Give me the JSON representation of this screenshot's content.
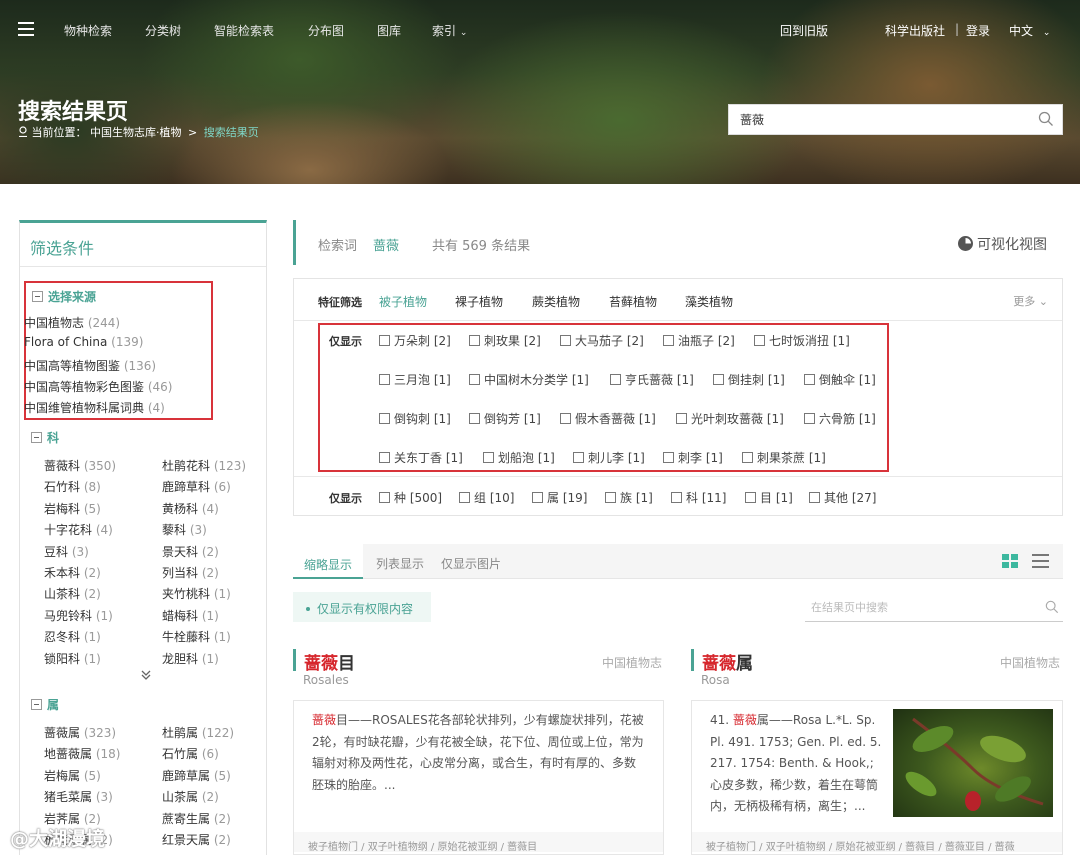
{
  "nav": {
    "items": [
      "物种检索",
      "分类树",
      "智能检索表",
      "分布图",
      "图库",
      "索引"
    ],
    "old_version": "回到旧版",
    "publisher": "科学出版社",
    "separator": "|",
    "login": "登录",
    "language": "中文"
  },
  "page": {
    "title": "搜索结果页",
    "location_label": "当前位置：",
    "crumb_home": "中国生物志库·植物",
    "crumb_sep": ">",
    "crumb_current": "搜索结果页"
  },
  "header_search": {
    "value": "蔷薇"
  },
  "sidebar": {
    "title": "筛选条件",
    "source_title": "选择来源",
    "sources": [
      {
        "name": "中国植物志",
        "count": "(244)"
      },
      {
        "name": "Flora of China",
        "count": "(139)"
      },
      {
        "name": "中国高等植物图鉴",
        "count": "(136)"
      },
      {
        "name": "中国高等植物彩色图鉴",
        "count": "(46)"
      },
      {
        "name": "中国维管植物科属词典",
        "count": "(4)"
      }
    ],
    "family_title": "科",
    "families": [
      {
        "name": "蔷薇科",
        "count": "(350)"
      },
      {
        "name": "杜鹃花科",
        "count": "(123)"
      },
      {
        "name": "石竹科",
        "count": "(8)"
      },
      {
        "name": "鹿蹄草科",
        "count": "(6)"
      },
      {
        "name": "岩梅科",
        "count": "(5)"
      },
      {
        "name": "黄杨科",
        "count": "(4)"
      },
      {
        "name": "十字花科",
        "count": "(4)"
      },
      {
        "name": "藜科",
        "count": "(3)"
      },
      {
        "name": "豆科",
        "count": "(3)"
      },
      {
        "name": "景天科",
        "count": "(2)"
      },
      {
        "name": "禾本科",
        "count": "(2)"
      },
      {
        "name": "列当科",
        "count": "(2)"
      },
      {
        "name": "山茶科",
        "count": "(2)"
      },
      {
        "name": "夹竹桃科",
        "count": "(1)"
      },
      {
        "name": "马兜铃科",
        "count": "(1)"
      },
      {
        "name": "蜡梅科",
        "count": "(1)"
      },
      {
        "name": "忍冬科",
        "count": "(1)"
      },
      {
        "name": "牛栓藤科",
        "count": "(1)"
      },
      {
        "name": "锁阳科",
        "count": "(1)"
      },
      {
        "name": "龙胆科",
        "count": "(1)"
      }
    ],
    "genus_title": "属",
    "genera": [
      {
        "name": "蔷薇属",
        "count": "(323)"
      },
      {
        "name": "杜鹃属",
        "count": "(122)"
      },
      {
        "name": "地蔷薇属",
        "count": "(18)"
      },
      {
        "name": "石竹属",
        "count": "(6)"
      },
      {
        "name": "岩梅属",
        "count": "(5)"
      },
      {
        "name": "鹿蹄草属",
        "count": "(5)"
      },
      {
        "name": "猪毛菜属",
        "count": "(3)"
      },
      {
        "name": "山茶属",
        "count": "(2)"
      },
      {
        "name": "岩荠属",
        "count": "(2)"
      },
      {
        "name": "蔗寄生属",
        "count": "(2)"
      },
      {
        "name": "板凳果属",
        "count": "(2)"
      },
      {
        "name": "红景天属",
        "count": "(2)"
      }
    ]
  },
  "query": {
    "label": "检索词",
    "keyword": "蔷薇",
    "total": "共有 569 条结果",
    "visualize": "可视化视图"
  },
  "filters": {
    "feature_label": "特征筛选",
    "categories": [
      "被子植物",
      "裸子植物",
      "蕨类植物",
      "苔藓植物",
      "藻类植物"
    ],
    "more": "更多",
    "only_label": "仅显示",
    "names": [
      "万朵刺 [2]",
      "刺玫果 [2]",
      "大马茄子 [2]",
      "油瓶子 [2]",
      "七时饭消扭 [1]",
      "三月泡 [1]",
      "中国树木分类学 [1]",
      "亨氏蔷薇 [1]",
      "倒挂刺 [1]",
      "倒触伞 [1]",
      "倒钩刺 [1]",
      "倒钩芳 [1]",
      "假木香蔷薇 [1]",
      "光叶刺玫蔷薇 [1]",
      "六骨筋 [1]",
      "关东丁香 [1]",
      "划船泡 [1]",
      "刺儿李 [1]",
      "刺李 [1]",
      "刺果茶蔗 [1]"
    ],
    "ranks": [
      "种 [500]",
      "组 [10]",
      "属 [19]",
      "族 [1]",
      "科 [11]",
      "目 [1]",
      "其他 [27]"
    ]
  },
  "view_tabs": [
    "缩略显示",
    "列表显示",
    "仅显示图片"
  ],
  "permission_only": "仅显示有权限内容",
  "results_search": {
    "placeholder": "在结果页中搜索"
  },
  "cards": [
    {
      "hl": "蔷薇",
      "title_rest": "目",
      "source": "中国植物志",
      "latin": "Rosales",
      "body_hl": "蔷薇",
      "body": "目——ROSALES花各部轮状排列，少有螺旋状排列，花被2轮，有时缺花瓣，少有花被全缺，花下位、周位或上位，常为辐射对称及两性花，心皮常分离，或合生，有时有厚的、多数胚珠的胎座。...",
      "path": "被子植物门 / 双子叶植物纲 / 原始花被亚纲 / 蔷薇目"
    },
    {
      "hl": "蔷薇",
      "title_rest": "属",
      "source": "中国植物志",
      "latin": "Rosa",
      "body_pre": "41. ",
      "body_hl": "蔷薇",
      "body": "属——Rosa L.*L. Sp. Pl. 491. 1753; Gen. Pl. ed. 5. 217. 1754: Benth. & Hook,; 心皮多数，稀少数，着生在萼筒内，无柄极稀有柄，离生；...",
      "path": "被子植物门 / 双子叶植物纲 / 原始花被亚纲 / 蔷薇目 / 蔷薇亚目 / 蔷薇"
    }
  ],
  "watermark": "@大湖漫境"
}
